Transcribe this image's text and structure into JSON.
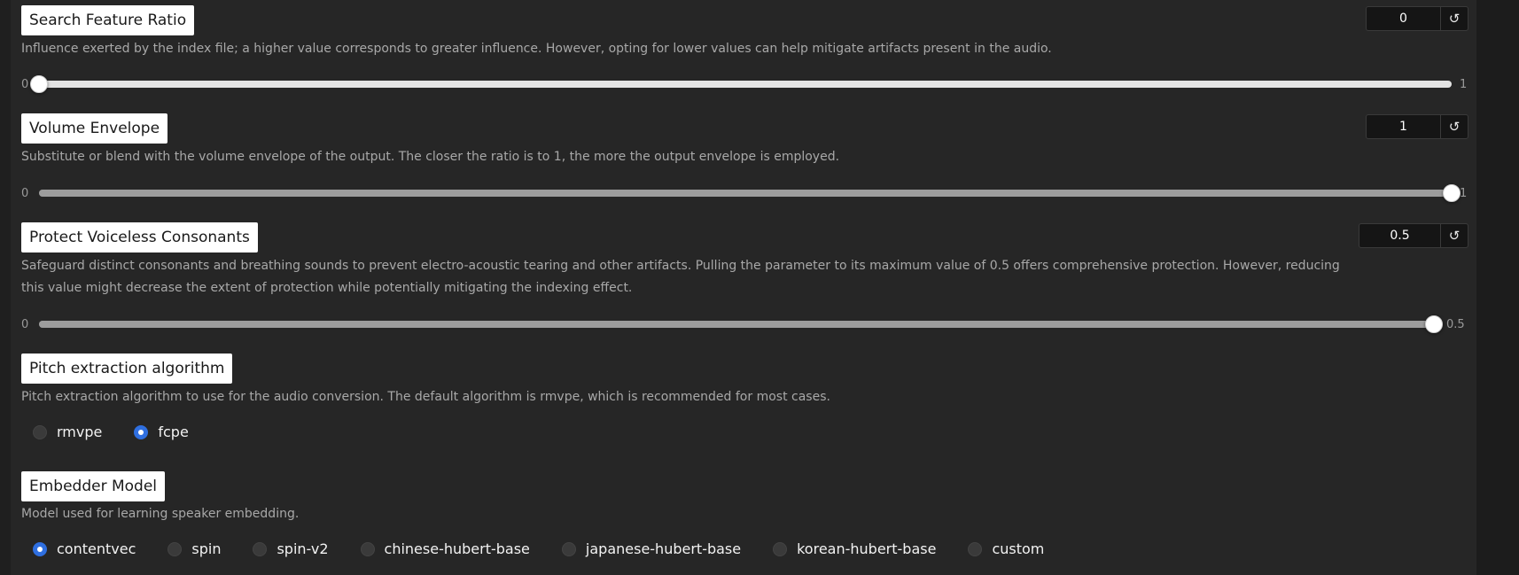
{
  "search_feature_ratio": {
    "label": "Search Feature Ratio",
    "description": "Influence exerted by the index file; a higher value corresponds to greater influence. However, opting for lower values can help mitigate artifacts present in the audio.",
    "value": "0",
    "min_label": "0",
    "max_label": "1",
    "level": 0,
    "reset_icon": "↺"
  },
  "volume_envelope": {
    "label": "Volume Envelope",
    "description": "Substitute or blend with the volume envelope of the output. The closer the ratio is to 1, the more the output envelope is employed.",
    "value": "1",
    "min_label": "0",
    "max_label": "1",
    "level": 1,
    "reset_icon": "↺"
  },
  "protect_voiceless": {
    "label": "Protect Voiceless Consonants",
    "description": "Safeguard distinct consonants and breathing sounds to prevent electro-acoustic tearing and other artifacts. Pulling the parameter to its maximum value of 0.5 offers comprehensive protection. However, reducing this value might decrease the extent of protection while potentially mitigating the indexing effect.",
    "value": "0.5",
    "min_label": "0",
    "max_label": "0.5",
    "level": 1,
    "reset_icon": "↺"
  },
  "pitch_extraction": {
    "label": "Pitch extraction algorithm",
    "description": "Pitch extraction algorithm to use for the audio conversion. The default algorithm is rmvpe, which is recommended for most cases.",
    "options": [
      "rmvpe",
      "fcpe"
    ],
    "selected": "fcpe"
  },
  "embedder_model": {
    "label": "Embedder Model",
    "description": "Model used for learning speaker embedding.",
    "options": [
      "contentvec",
      "spin",
      "spin-v2",
      "chinese-hubert-base",
      "japanese-hubert-base",
      "korean-hubert-base",
      "custom"
    ],
    "selected": "contentvec"
  },
  "colors": {
    "accent": "#2f6fe0",
    "panel": "#262626"
  }
}
